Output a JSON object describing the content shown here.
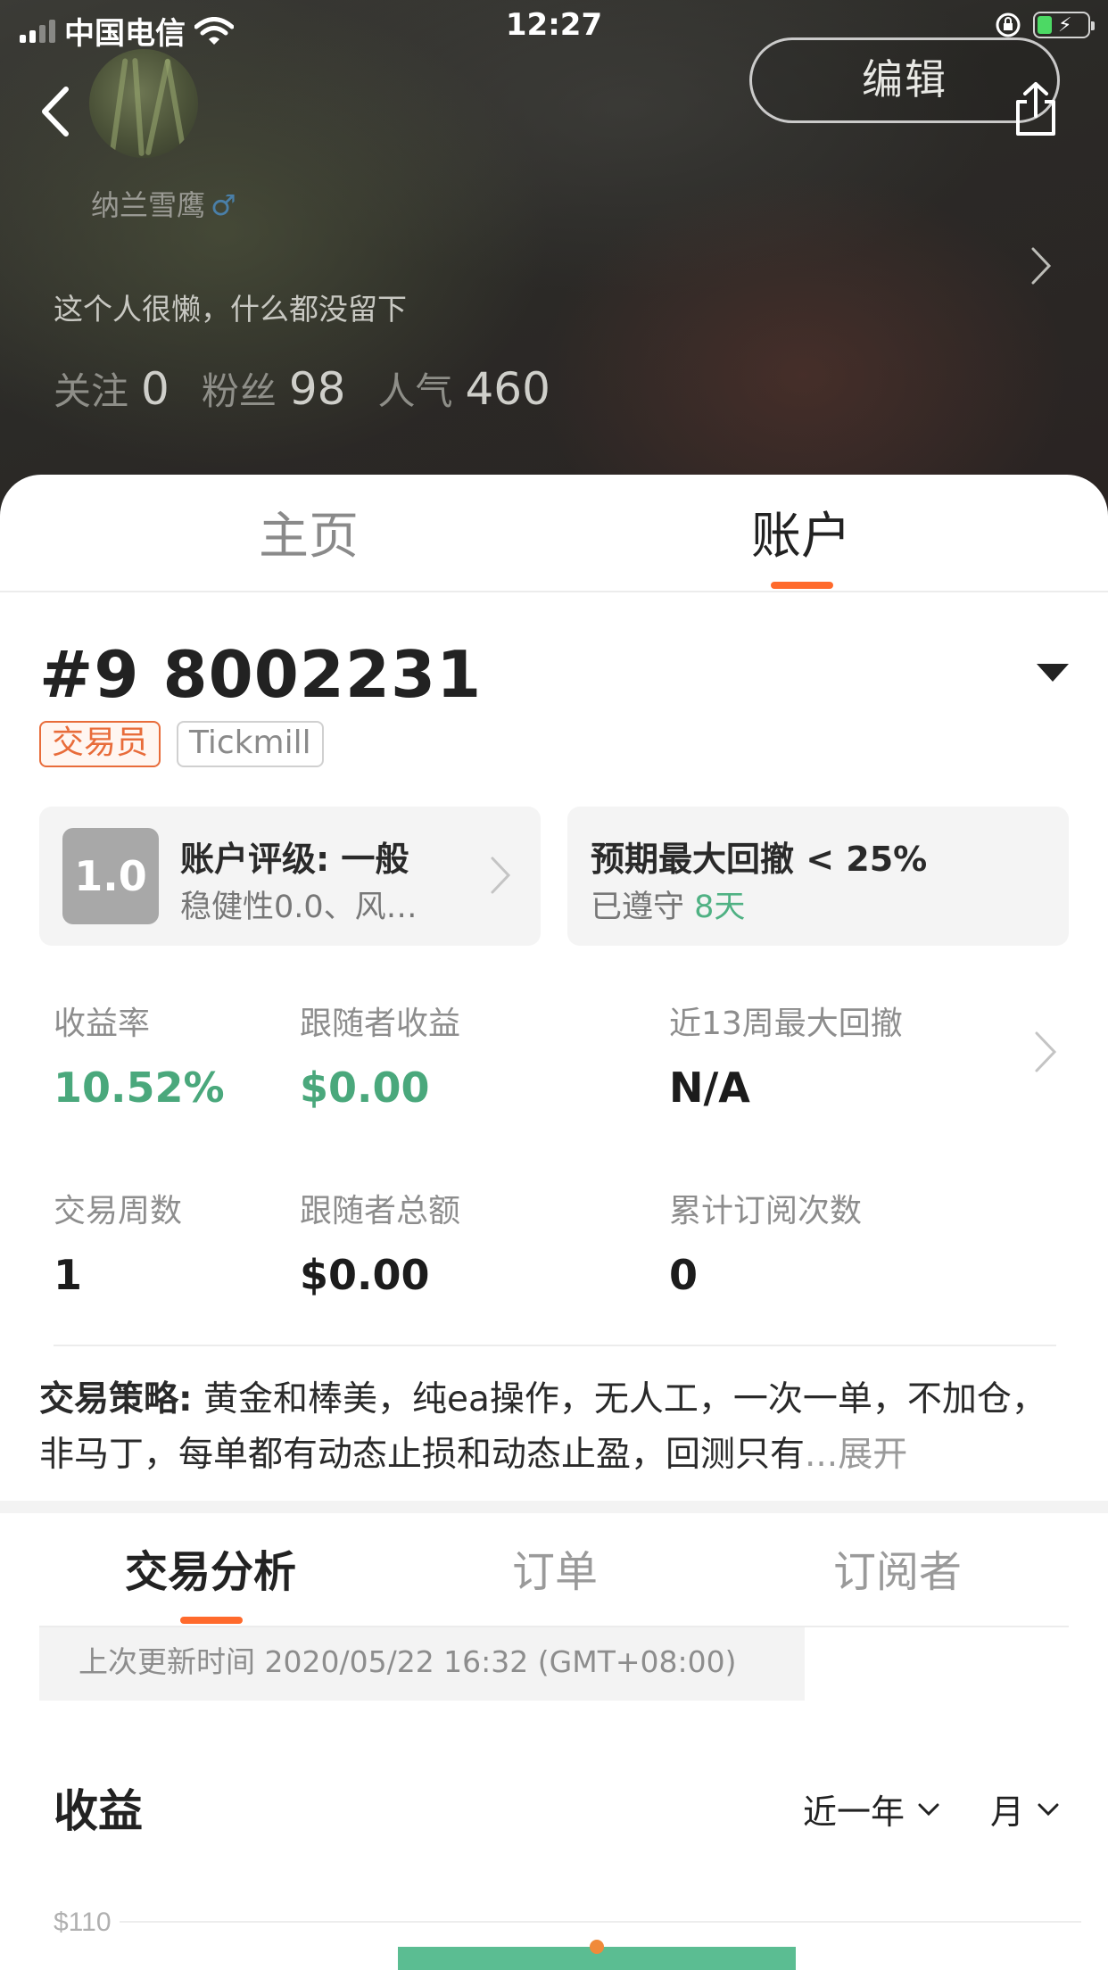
{
  "status_bar": {
    "carrier": "中国电信",
    "time": "12:27"
  },
  "profile": {
    "username": "纳兰雪鹰",
    "gender_symbol": "♂",
    "bio": "这个人很懒，什么都没留下",
    "edit_label": "编辑",
    "stats": [
      {
        "label": "关注",
        "value": "0"
      },
      {
        "label": "粉丝",
        "value": "98"
      },
      {
        "label": "人气",
        "value": "460"
      }
    ]
  },
  "top_tabs": [
    {
      "label": "主页",
      "active": false
    },
    {
      "label": "账户",
      "active": true
    }
  ],
  "account": {
    "number": "#9 8002231",
    "badges": [
      "交易员",
      "Tickmill"
    ],
    "rating": {
      "score": "1.0",
      "title": "账户评级: 一般",
      "detail": "稳健性0.0、风…"
    },
    "drawdown": {
      "title": "预期最大回撤 < 25%",
      "kept_prefix": "已遵守 ",
      "kept_days": "8天"
    },
    "metrics": [
      {
        "label": "收益率",
        "value": "10.52%",
        "green": true
      },
      {
        "label": "跟随者收益",
        "value": "$0.00",
        "green": true
      },
      {
        "label": "近13周最大回撤",
        "value": "N/A",
        "green": false
      },
      {
        "label": "交易周数",
        "value": "1",
        "green": false
      },
      {
        "label": "跟随者总额",
        "value": "$0.00",
        "green": false
      },
      {
        "label": "累计订阅次数",
        "value": "0",
        "green": false
      }
    ],
    "strategy_label": "交易策略:",
    "strategy_text": " 黄金和棒美，纯ea操作，无人工，一次一单，不加仓，非马丁，每单都有动态止损和动态止盈，回测只有",
    "strategy_more": "...展开"
  },
  "sub_tabs": [
    {
      "label": "交易分析",
      "active": true
    },
    {
      "label": "订单",
      "active": false
    },
    {
      "label": "订阅者",
      "active": false
    }
  ],
  "analysis": {
    "updated": "上次更新时间 2020/05/22 16:32 (GMT+08:00)",
    "income_title": "收益",
    "range_filter": "近一年",
    "period_filter": "月"
  },
  "chart_data": {
    "type": "bar",
    "y_tick_labels": [
      "$110"
    ],
    "colors": {
      "bar": "#5bbd92",
      "point": "#f08a3a"
    }
  },
  "colors": {
    "accent": "#ff6a2c",
    "positive": "#4aa87c",
    "badge_trader": "#e86c3a"
  }
}
